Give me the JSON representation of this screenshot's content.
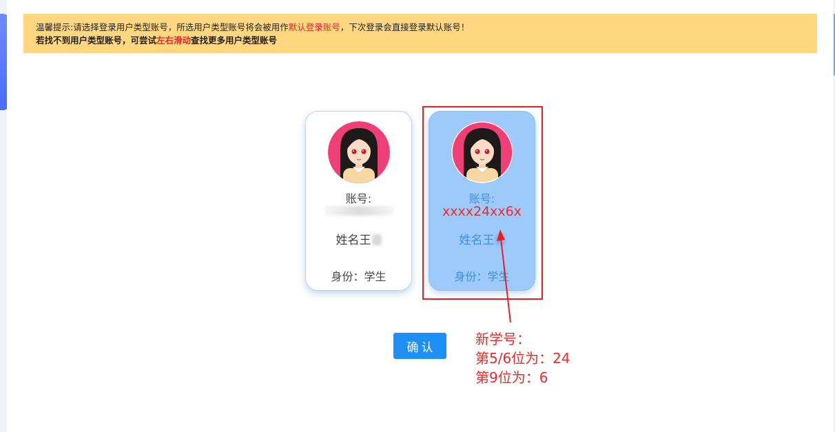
{
  "notice": {
    "line1_pre": "温馨提示:请选择登录用户类型账号，所选用户类型账号将会被用作",
    "line1_hl": "默认登录账号",
    "line1_post": "，下次登录会直接登录默认账号！",
    "line2_pre": "若找不到用户类型账号，可尝试",
    "line2_hl": "左右滑动",
    "line2_post": "查找更多用户类型账号"
  },
  "cards": [
    {
      "account_label": "账号:",
      "name": "姓名王",
      "role": "身份：学生",
      "avatar_icon": "student-girl-avatar"
    },
    {
      "account_label": "账号:",
      "account_value": "xxxx24xx6x",
      "name": "姓名王",
      "role": "身份：学生",
      "avatar_icon": "student-girl-avatar"
    }
  ],
  "confirm_label": "确认",
  "annotation": {
    "line1": "新学号：",
    "line2": "第5/6位为：24",
    "line3": "第9位为：6"
  },
  "colors": {
    "notice_bg": "#ffd77f",
    "highlight": "#e8262f",
    "selected_card": "#9ccbfb",
    "button": "#1d8ff5"
  }
}
